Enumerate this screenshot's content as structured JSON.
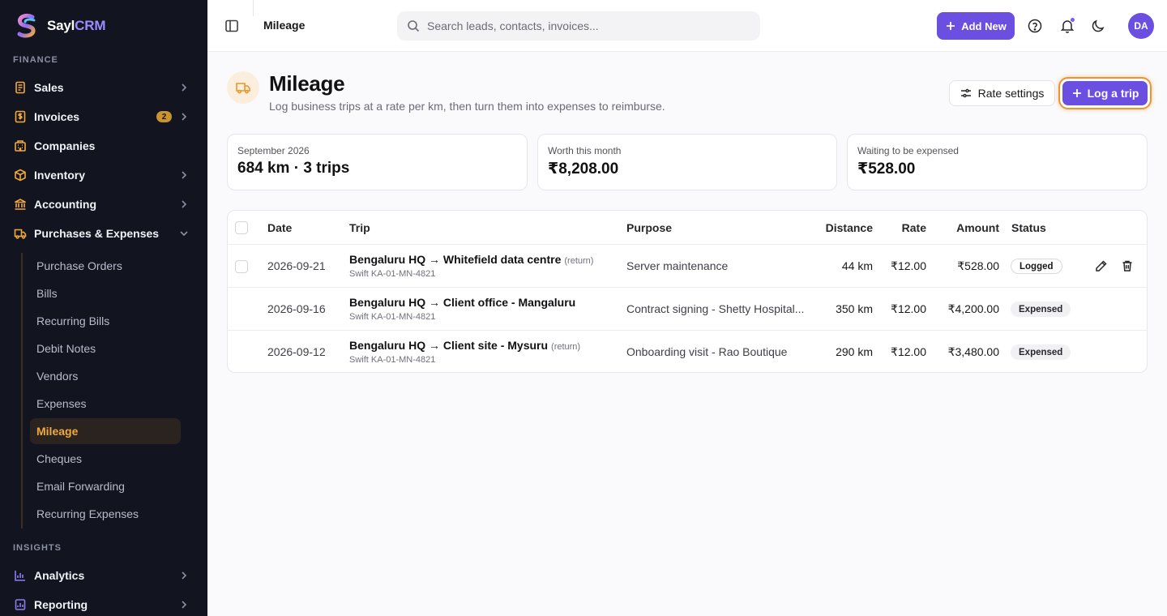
{
  "brand": {
    "name_prefix": "Sayl",
    "name_suffix": "CRM"
  },
  "sidebar": {
    "sections": [
      {
        "label": "FINANCE"
      },
      {
        "label": "INSIGHTS"
      }
    ],
    "items": [
      {
        "label": "Sales",
        "icon": "document-icon"
      },
      {
        "label": "Invoices",
        "icon": "dollar-doc-icon",
        "badge": "2"
      },
      {
        "label": "Companies",
        "icon": "building-icon"
      },
      {
        "label": "Inventory",
        "icon": "box-icon"
      },
      {
        "label": "Accounting",
        "icon": "bank-icon"
      },
      {
        "label": "Purchases & Expenses",
        "icon": "truck-icon"
      },
      {
        "label": "Analytics",
        "icon": "bar-chart-icon"
      },
      {
        "label": "Reporting",
        "icon": "report-icon"
      }
    ],
    "sub_items": [
      {
        "label": "Purchase Orders"
      },
      {
        "label": "Bills"
      },
      {
        "label": "Recurring Bills"
      },
      {
        "label": "Debit Notes"
      },
      {
        "label": "Vendors"
      },
      {
        "label": "Expenses"
      },
      {
        "label": "Mileage",
        "active": true
      },
      {
        "label": "Cheques"
      },
      {
        "label": "Email Forwarding"
      },
      {
        "label": "Recurring Expenses"
      }
    ]
  },
  "topbar": {
    "breadcrumb": "Mileage",
    "search_placeholder": "Search leads, contacts, invoices...",
    "add_new_label": "Add New",
    "avatar_initials": "DA"
  },
  "page": {
    "title": "Mileage",
    "subtitle": "Log business trips at a rate per km, then turn them into expenses to reimburse.",
    "rate_settings_label": "Rate settings",
    "log_trip_label": "Log a trip"
  },
  "stats": [
    {
      "label": "September 2026",
      "value": "684 km · 3 trips"
    },
    {
      "label": "Worth this month",
      "value": "₹8,208.00"
    },
    {
      "label": "Waiting to be expensed",
      "value": "₹528.00"
    }
  ],
  "table": {
    "columns": {
      "date": "Date",
      "trip": "Trip",
      "purpose": "Purpose",
      "distance": "Distance",
      "rate": "Rate",
      "amount": "Amount",
      "status": "Status"
    },
    "rows": [
      {
        "date": "2026-09-21",
        "trip": "Bengaluru HQ → Whitefield data centre",
        "return_tag": "(return)",
        "vehicle": "Swift KA-01-MN-4821",
        "purpose": "Server maintenance",
        "distance": "44 km",
        "rate": "₹12.00",
        "amount": "₹528.00",
        "status": "Logged"
      },
      {
        "date": "2026-09-16",
        "trip": "Bengaluru HQ → Client office - Mangaluru",
        "return_tag": "",
        "vehicle": "Swift KA-01-MN-4821",
        "purpose": "Contract signing - Shetty Hospital...",
        "distance": "350 km",
        "rate": "₹12.00",
        "amount": "₹4,200.00",
        "status": "Expensed"
      },
      {
        "date": "2026-09-12",
        "trip": "Bengaluru HQ → Client site - Mysuru",
        "return_tag": "(return)",
        "vehicle": "Swift KA-01-MN-4821",
        "purpose": "Onboarding visit - Rao Boutique",
        "distance": "290 km",
        "rate": "₹12.00",
        "amount": "₹3,480.00",
        "status": "Expensed"
      }
    ]
  },
  "colors": {
    "accent": "#6b4fe0",
    "sidebar_bg": "#121420",
    "sidebar_active": "#f2a93b",
    "focus_ring": "#f0922e"
  }
}
